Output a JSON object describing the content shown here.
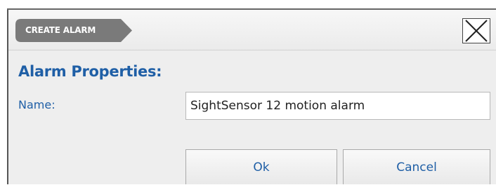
{
  "dialog": {
    "breadcrumb": "CREATE ALARM",
    "close_icon": "close-x-icon",
    "section_title": "Alarm Properties:",
    "name_label": "Name:",
    "name_value": "SightSensor 12 motion alarm",
    "ok_label": "Ok",
    "cancel_label": "Cancel"
  },
  "colors": {
    "accent_text": "#1f5fa6",
    "breadcrumb_bg": "#7a7a7a",
    "dialog_bg": "#eeeeee"
  }
}
